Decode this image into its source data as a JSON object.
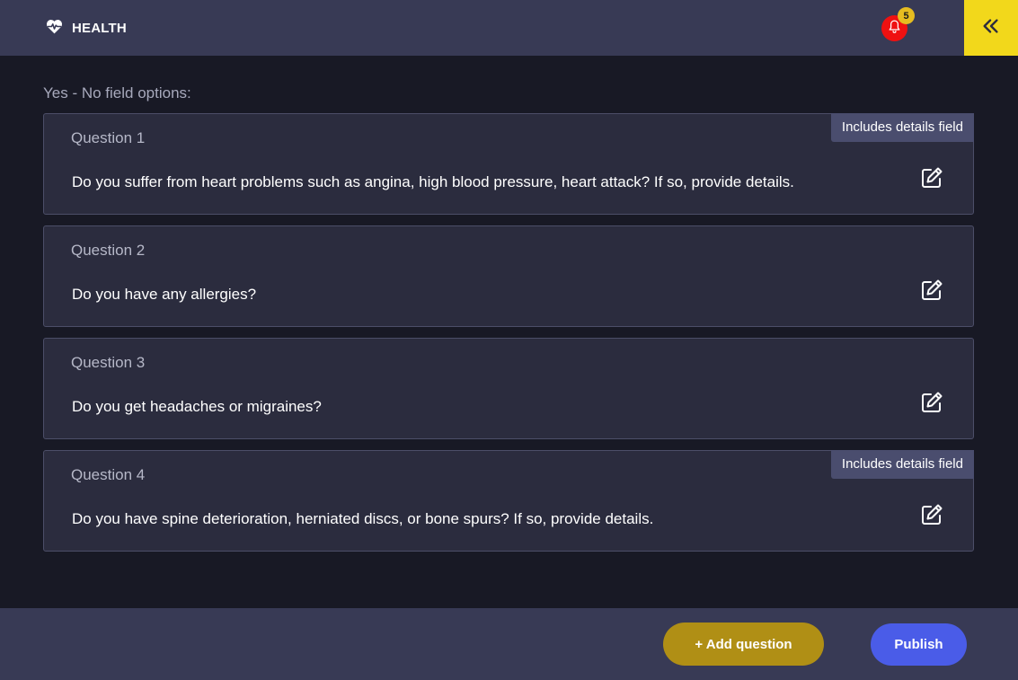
{
  "header": {
    "brand_label": "HEALTH",
    "brand_icon": "heart-pulse-icon",
    "notifications_count": "5",
    "notification_icon": "bell-icon",
    "collapse_icon": "double-chevron-left-icon"
  },
  "section": {
    "label": "Yes - No field options:"
  },
  "questions": [
    {
      "title": "Question 1",
      "text": "Do you suffer from heart problems such as angina, high blood pressure, heart attack? If so, provide details.",
      "details_tag": "Includes details field"
    },
    {
      "title": "Question 2",
      "text": "Do you have any allergies?",
      "details_tag": ""
    },
    {
      "title": "Question 3",
      "text": "Do you get headaches or migraines?",
      "details_tag": ""
    },
    {
      "title": "Question 4",
      "text": "Do you have spine deterioration, herniated discs, or bone spurs? If so, provide details.",
      "details_tag": "Includes details field"
    }
  ],
  "footer": {
    "add_label": "+ Add question",
    "publish_label": "Publish"
  },
  "colors": {
    "background": "#181925",
    "bar": "#383a55",
    "card": "#2b2c3e",
    "accent_yellow": "#f2d81b",
    "notification_red": "#ef1111",
    "add_button": "#b08f15",
    "publish_button": "#4a5ce8"
  }
}
